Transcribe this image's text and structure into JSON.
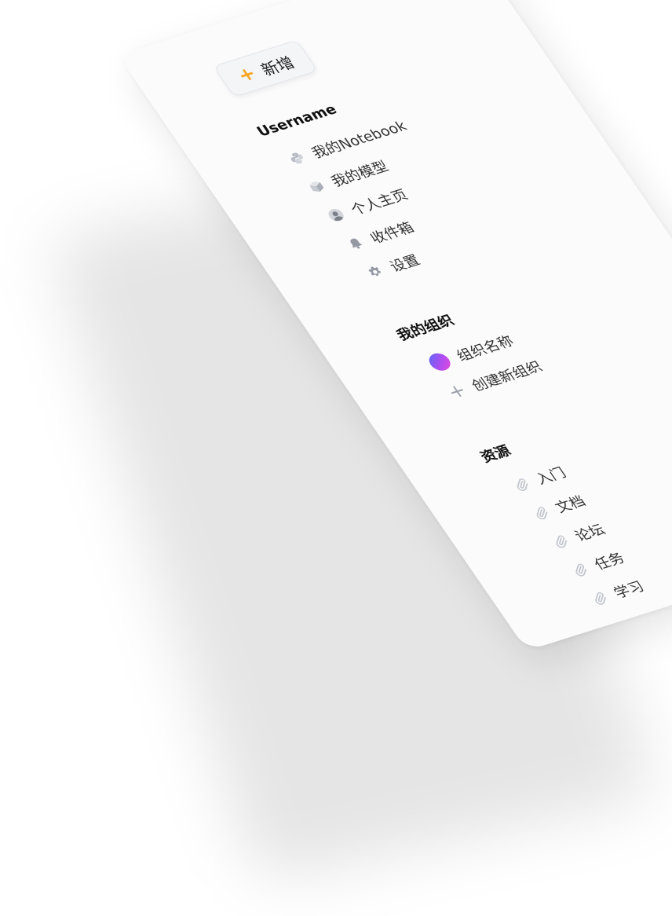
{
  "new_button": {
    "icon": "plus-icon",
    "label": "新增"
  },
  "account": {
    "title": "Username",
    "items": [
      {
        "icon": "python-icon",
        "label": "我的Notebook"
      },
      {
        "icon": "cube-icon",
        "label": "我的模型"
      },
      {
        "icon": "user-avatar-icon",
        "label": "个人主页"
      },
      {
        "icon": "bell-icon",
        "label": "收件箱"
      },
      {
        "icon": "gear-icon",
        "label": "设置"
      }
    ]
  },
  "organization": {
    "title": "我的组织",
    "items": [
      {
        "icon": "org-avatar-icon",
        "label": "组织名称"
      },
      {
        "icon": "plus-icon",
        "label": "创建新组织"
      }
    ]
  },
  "resources": {
    "title": "资源",
    "items": [
      {
        "icon": "paperclip-icon",
        "label": "入门"
      },
      {
        "icon": "paperclip-icon",
        "label": "文档"
      },
      {
        "icon": "paperclip-icon",
        "label": "论坛"
      },
      {
        "icon": "paperclip-icon",
        "label": "任务"
      },
      {
        "icon": "paperclip-icon",
        "label": "学习"
      }
    ]
  },
  "colors": {
    "accent": "#f5a623",
    "card_bg": "#fbfbfc",
    "org_gradient_start": "#4f6cf7",
    "org_gradient_end": "#e94ad8"
  }
}
